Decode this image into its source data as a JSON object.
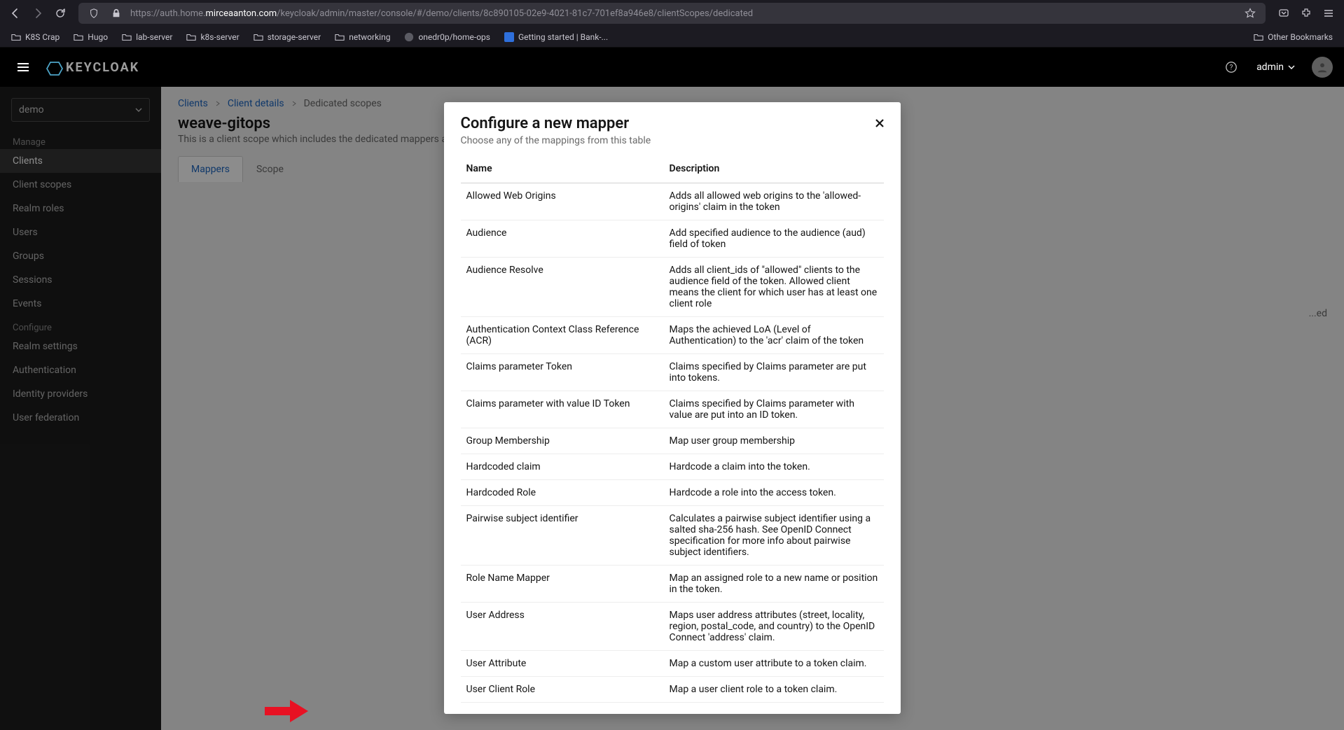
{
  "browser": {
    "url_prefix": "https://auth.home.",
    "url_host": "mirceaanton.com",
    "url_path": "/keycloak/admin/master/console/#/demo/clients/8c890105-02e9-4021-81c7-701ef8a946e8/clientScopes/dedicated",
    "bookmarks": [
      {
        "label": "K8S Crap",
        "kind": "folder"
      },
      {
        "label": "Hugo",
        "kind": "folder"
      },
      {
        "label": "lab-server",
        "kind": "folder"
      },
      {
        "label": "k8s-server",
        "kind": "folder"
      },
      {
        "label": "storage-server",
        "kind": "folder"
      },
      {
        "label": "networking",
        "kind": "folder"
      },
      {
        "label": "onedr0p/home-ops",
        "kind": "github"
      },
      {
        "label": "Getting started | Bank-...",
        "kind": "favicon"
      }
    ],
    "other_bookmarks": "Other Bookmarks"
  },
  "header": {
    "brand": "KEYCLOAK",
    "user": "admin"
  },
  "sidebar": {
    "realm": "demo",
    "sections": [
      {
        "heading": "Manage",
        "items": [
          "Clients",
          "Client scopes",
          "Realm roles",
          "Users",
          "Groups",
          "Sessions",
          "Events"
        ],
        "active": "Clients"
      },
      {
        "heading": "Configure",
        "items": [
          "Realm settings",
          "Authentication",
          "Identity providers",
          "User federation"
        ]
      }
    ]
  },
  "main": {
    "breadcrumb": [
      "Clients",
      "Client details",
      "Dedicated scopes"
    ],
    "title": "weave-gitops",
    "desc": "This is a client scope which includes the dedicated mappers and scope for this client.",
    "tabs": [
      "Mappers",
      "Scope"
    ],
    "active_tab": "Mappers",
    "row_trailing_text": "...ed"
  },
  "modal": {
    "title": "Configure a new mapper",
    "subtitle": "Choose any of the mappings from this table",
    "columns": [
      "Name",
      "Description"
    ],
    "mappers": [
      {
        "name": "Allowed Web Origins",
        "desc": "Adds all allowed web origins to the 'allowed-origins' claim in the token"
      },
      {
        "name": "Audience",
        "desc": "Add specified audience to the audience (aud) field of token"
      },
      {
        "name": "Audience Resolve",
        "desc": "Adds all client_ids of \"allowed\" clients to the audience field of the token. Allowed client means the client for which user has at least one client role"
      },
      {
        "name": "Authentication Context Class Reference (ACR)",
        "desc": "Maps the achieved LoA (Level of Authentication) to the 'acr' claim of the token"
      },
      {
        "name": "Claims parameter Token",
        "desc": "Claims specified by Claims parameter are put into tokens."
      },
      {
        "name": "Claims parameter with value ID Token",
        "desc": "Claims specified by Claims parameter with value are put into an ID token."
      },
      {
        "name": "Group Membership",
        "desc": "Map user group membership"
      },
      {
        "name": "Hardcoded claim",
        "desc": "Hardcode a claim into the token."
      },
      {
        "name": "Hardcoded Role",
        "desc": "Hardcode a role into the access token."
      },
      {
        "name": "Pairwise subject identifier",
        "desc": "Calculates a pairwise subject identifier using a salted sha-256 hash. See OpenID Connect specification for more info about pairwise subject identifiers."
      },
      {
        "name": "Role Name Mapper",
        "desc": "Map an assigned role to a new name or position in the token."
      },
      {
        "name": "User Address",
        "desc": "Maps user address attributes (street, locality, region, postal_code, and country) to the OpenID Connect 'address' claim."
      },
      {
        "name": "User Attribute",
        "desc": "Map a custom user attribute to a token claim."
      },
      {
        "name": "User Client Role",
        "desc": "Map a user client role to a token claim."
      }
    ]
  }
}
